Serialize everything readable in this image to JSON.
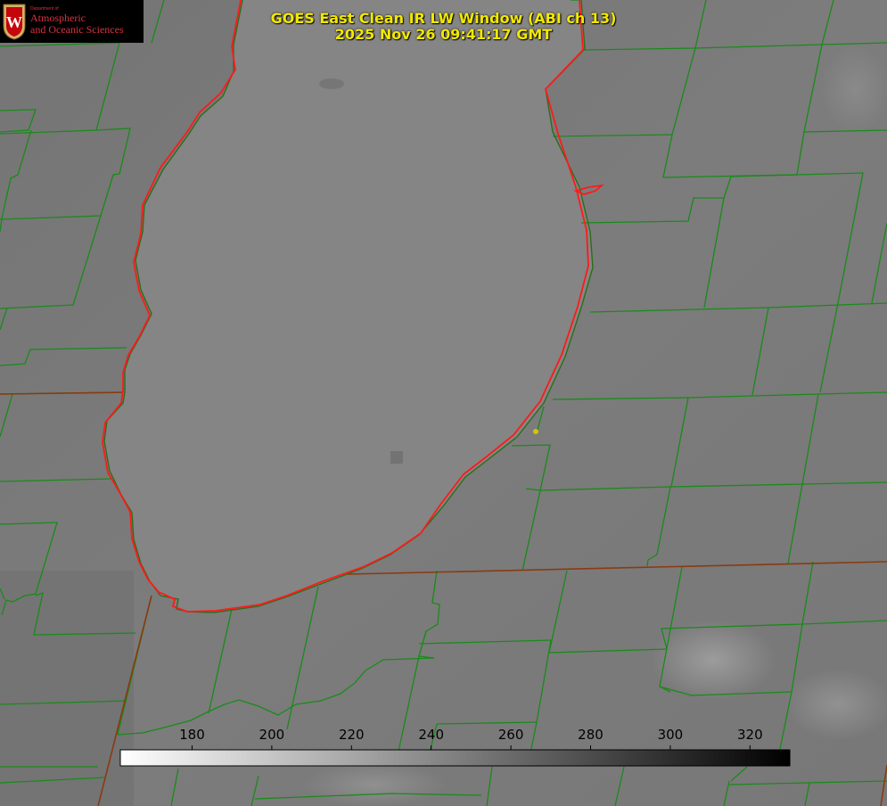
{
  "header": {
    "title_line1": "GOES East Clean IR LW Window (ABI ch 13)",
    "title_line2": "2025 Nov 26 09:41:17 GMT"
  },
  "logo": {
    "department": "Department of",
    "name_line1": "Atmospheric",
    "name_line2": "and Oceanic Sciences",
    "crest_letter": "W"
  },
  "colorbar": {
    "ticks": [
      "180",
      "200",
      "220",
      "240",
      "260",
      "280",
      "300",
      "320"
    ],
    "tick_values": [
      180,
      200,
      220,
      240,
      260,
      280,
      300,
      320
    ],
    "range": [
      162,
      330
    ],
    "colors": {
      "low": "#ffffff",
      "high": "#000000"
    }
  },
  "map": {
    "colors": {
      "background": "#7a7a7a",
      "lake": "#888888",
      "county_lines": "#1a8a1a",
      "state_lines": "#8a3a10",
      "shoreline_highlight": "#ff1a1a",
      "marker": "#d4c400"
    }
  }
}
